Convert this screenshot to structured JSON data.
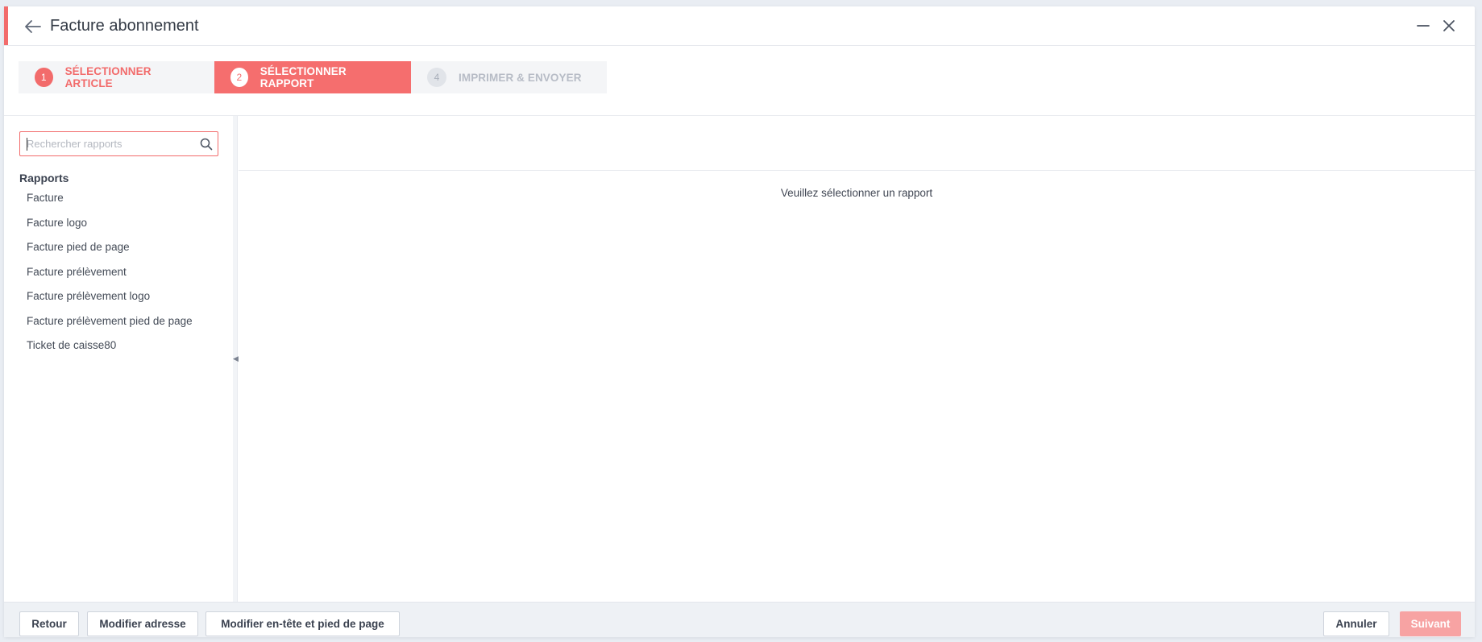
{
  "window": {
    "title": "Facture abonnement"
  },
  "stepper": {
    "steps": [
      {
        "number": "1",
        "label": "SÉLECTIONNER ARTICLE",
        "state": "completed"
      },
      {
        "number": "2",
        "label": "SÉLECTIONNER RAPPORT",
        "state": "active"
      },
      {
        "number": "4",
        "label": "IMPRIMER & ENVOYER",
        "state": "disabled"
      }
    ]
  },
  "sidebar": {
    "search": {
      "value": "",
      "placeholder": "Rechercher rapports"
    },
    "section_label": "Rapports",
    "items": [
      {
        "label": "Facture"
      },
      {
        "label": "Facture logo"
      },
      {
        "label": "Facture pied de page"
      },
      {
        "label": "Facture prélèvement"
      },
      {
        "label": "Facture prélèvement logo"
      },
      {
        "label": "Facture prélèvement pied de page"
      },
      {
        "label": "Ticket de caisse80"
      }
    ]
  },
  "main": {
    "empty_message": "Veuillez sélectionner un rapport"
  },
  "footer": {
    "retour_label": "Retour",
    "adresse_label": "Modifier adresse",
    "entete_label": "Modifier en-tête et pied de page",
    "annuler_label": "Annuler",
    "suivant_label": "Suivant"
  },
  "colors": {
    "accent": "#f26b6b",
    "active_step": "#f56e6e",
    "disabled_primary": "#f7a3a3",
    "footer_bg": "#eef1f5"
  },
  "icons": {
    "back": "arrow-left-icon",
    "minimize": "minimize-icon",
    "close": "close-icon",
    "search": "search-icon",
    "splitter": "chevron-left-icon"
  }
}
